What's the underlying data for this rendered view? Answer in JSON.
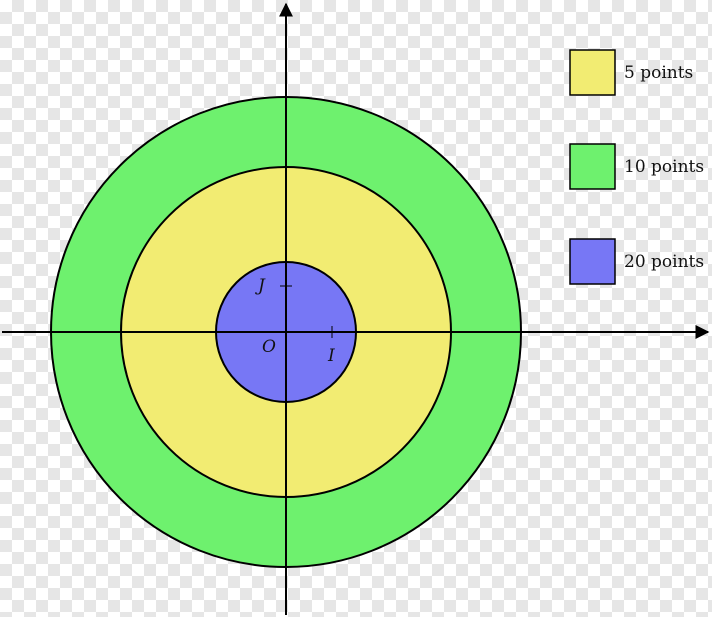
{
  "target": {
    "rings": [
      {
        "name": "outer",
        "color": "#6ef16e",
        "points_label": "10 points"
      },
      {
        "name": "middle",
        "color": "#f2ec72",
        "points_label": "5 points"
      },
      {
        "name": "inner",
        "color": "#7777f5",
        "points_label": "20 points"
      }
    ],
    "labels": {
      "origin": "O",
      "unit_x": "I",
      "unit_y": "J"
    }
  },
  "legend": [
    {
      "label": "5 points",
      "color": "#f2ec72"
    },
    {
      "label": "10 points",
      "color": "#6ef16e"
    },
    {
      "label": "20 points",
      "color": "#7777f5"
    }
  ]
}
